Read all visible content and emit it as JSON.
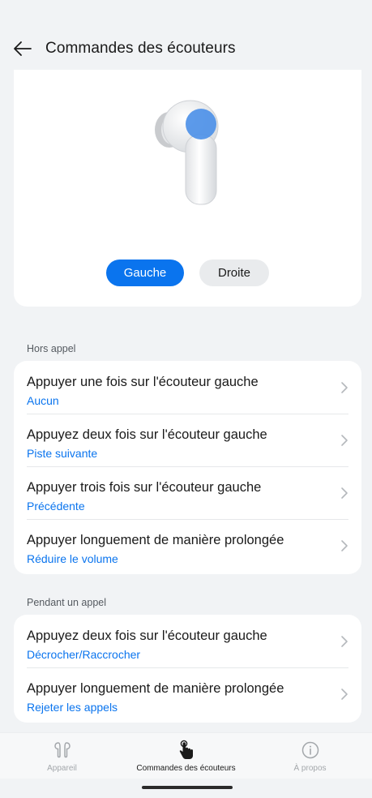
{
  "header": {
    "title": "Commandes des écouteurs"
  },
  "earbud": {
    "left_label": "Gauche",
    "right_label": "Droite",
    "selected": "left",
    "accent_color": "#0a74ee"
  },
  "sections": [
    {
      "label": "Hors appel",
      "rows": [
        {
          "title": "Appuyer une fois sur l'écouteur gauche",
          "value": "Aucun"
        },
        {
          "title": "Appuyez deux fois sur l'écouteur gauche",
          "value": "Piste suivante"
        },
        {
          "title": "Appuyer trois fois sur l'écouteur gauche",
          "value": "Précédente"
        },
        {
          "title": "Appuyer longuement de manière prolongée",
          "value": "Réduire le volume"
        }
      ]
    },
    {
      "label": "Pendant un appel",
      "rows": [
        {
          "title": "Appuyez deux fois sur l'écouteur gauche",
          "value": "Décrocher/Raccrocher"
        },
        {
          "title": "Appuyer longuement de manière prolongée",
          "value": "Rejeter les appels"
        }
      ]
    }
  ],
  "bottom_nav": [
    {
      "label": "Appareil",
      "icon": "earbuds-icon",
      "active": false
    },
    {
      "label": "Commandes des écouteurs",
      "icon": "touch-hand-icon",
      "active": true
    },
    {
      "label": "À propos",
      "icon": "info-icon",
      "active": false
    }
  ]
}
